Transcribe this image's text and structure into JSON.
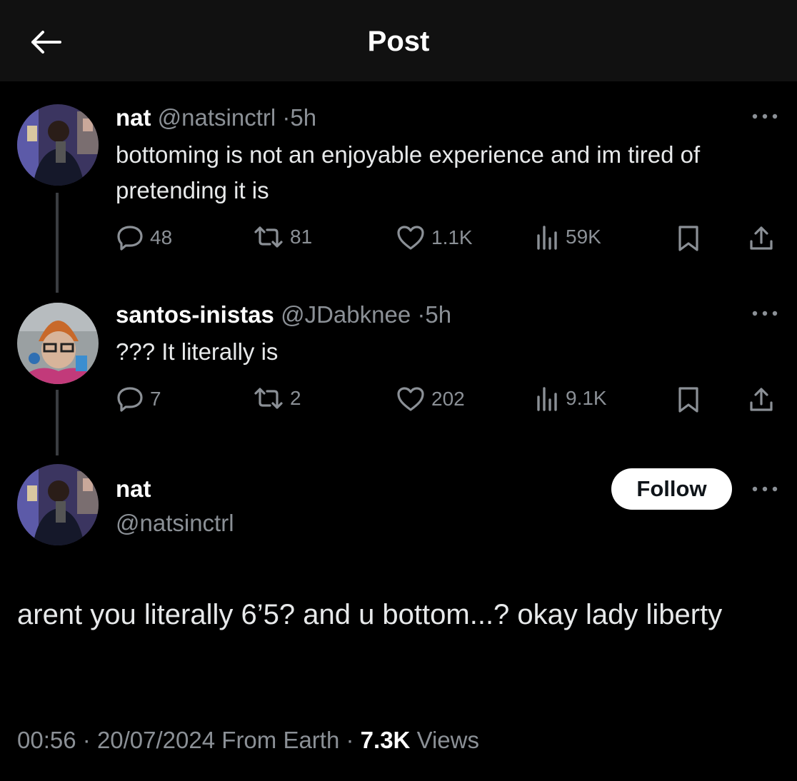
{
  "header": {
    "title": "Post"
  },
  "tweets": [
    {
      "display_name": "nat",
      "handle": "@natsinctrl",
      "time": "5h",
      "text": "bottoming is not an enjoyable experience and im tired of pretending it is",
      "replies": "48",
      "reposts": "81",
      "likes": "1.1K",
      "views": "59K"
    },
    {
      "display_name": "santos-inistas",
      "handle": "@JDabknee",
      "time": "5h",
      "text": "??? It literally is",
      "replies": "7",
      "reposts": "2",
      "likes": "202",
      "views": "9.1K"
    }
  ],
  "main_post": {
    "display_name": "nat",
    "handle": "@natsinctrl",
    "follow_label": "Follow",
    "text": "arent you literally 6’5? and u bottom...? okay lady liberty",
    "time": "00:56",
    "date": "20/07/2024",
    "source": "From Earth",
    "views_count": "7.3K",
    "views_label": "Views"
  },
  "separator": "·",
  "colors": {
    "background": "#000000",
    "header": "#111111",
    "text": "#e7e9ea",
    "muted": "#8b9096",
    "follow_bg": "#ffffff"
  },
  "icons": [
    "back-arrow-icon",
    "more-icon",
    "reply-icon",
    "repost-icon",
    "like-icon",
    "views-icon",
    "bookmark-icon",
    "share-icon"
  ]
}
